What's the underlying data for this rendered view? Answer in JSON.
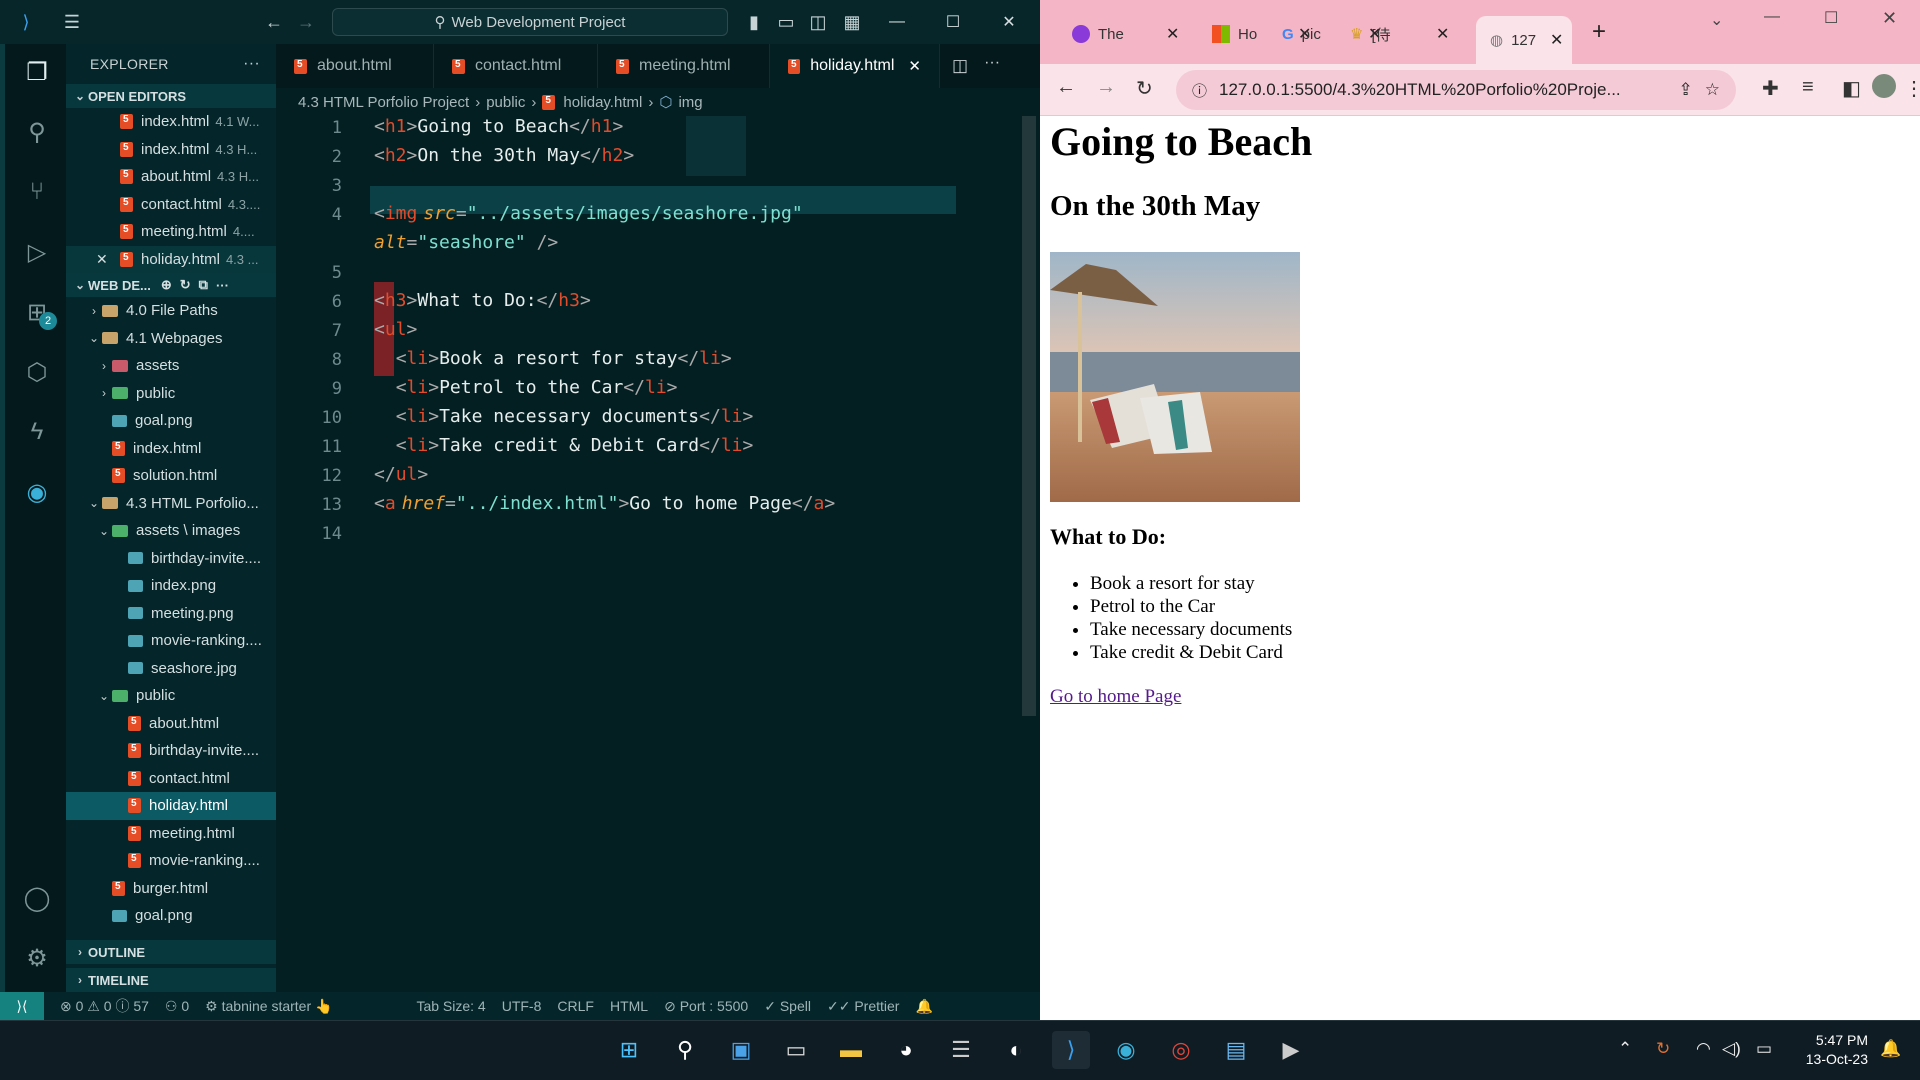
{
  "vscode": {
    "search_text": "Web Development Project",
    "explorer_title": "EXPLORER",
    "open_editors_title": "OPEN EDITORS",
    "open_editors": [
      {
        "name": "index.html",
        "hint": "4.1 W..."
      },
      {
        "name": "index.html",
        "hint": "4.3 H..."
      },
      {
        "name": "about.html",
        "hint": "4.3 H..."
      },
      {
        "name": "contact.html",
        "hint": "4.3...."
      },
      {
        "name": "meeting.html",
        "hint": "4...."
      },
      {
        "name": "holiday.html",
        "hint": "4.3 ..."
      }
    ],
    "workspace_title": "WEB DE...",
    "tree": [
      {
        "label": "4.0 File Paths"
      },
      {
        "label": "4.1 Webpages"
      },
      {
        "label": "assets"
      },
      {
        "label": "public"
      },
      {
        "label": "goal.png"
      },
      {
        "label": "index.html"
      },
      {
        "label": "solution.html"
      },
      {
        "label": "4.3 HTML Porfolio..."
      },
      {
        "label": "assets \\ images"
      },
      {
        "label": "birthday-invite...."
      },
      {
        "label": "index.png"
      },
      {
        "label": "meeting.png"
      },
      {
        "label": "movie-ranking...."
      },
      {
        "label": "seashore.jpg"
      },
      {
        "label": "public"
      },
      {
        "label": "about.html"
      },
      {
        "label": "birthday-invite...."
      },
      {
        "label": "contact.html"
      },
      {
        "label": "holiday.html"
      },
      {
        "label": "meeting.html"
      },
      {
        "label": "movie-ranking...."
      },
      {
        "label": "burger.html"
      },
      {
        "label": "goal.png"
      }
    ],
    "outline_title": "OUTLINE",
    "timeline_title": "TIMELINE",
    "tabs": [
      "about.html",
      "contact.html",
      "meeting.html",
      "holiday.html"
    ],
    "breadcrumb": [
      "4.3 HTML Porfolio Project",
      "public",
      "holiday.html",
      "img"
    ],
    "line_numbers": [
      "1",
      "2",
      "3",
      "4",
      "",
      "5",
      "6",
      "7",
      "8",
      "9",
      "10",
      "11",
      "12",
      "13",
      "14"
    ],
    "status": {
      "problems": "0",
      "warnings": "0",
      "info": "57",
      "ports": "0",
      "tabnine": "tabnine starter",
      "tab_size": "Tab Size: 4",
      "encoding": "UTF-8",
      "eol": "CRLF",
      "language": "HTML",
      "port": "Port : 5500",
      "spell": "Spell",
      "prettier": "Prettier"
    }
  },
  "code_lines": [
    {
      "pre": "<",
      "tag": "h1",
      "mid": ">",
      "text": "Going to Beach",
      "close": "</",
      "ctag": "h1",
      "end": ">"
    },
    {
      "pre": "<",
      "tag": "h2",
      "mid": ">",
      "text": "On the 30th May",
      "close": "</",
      "ctag": "h2",
      "end": ">"
    },
    {
      "pre": "<",
      "tag": "img",
      "attr1": "src",
      "eq1": "=",
      "val1": "\"../assets/images/seashore.jpg\""
    },
    {
      "attr2": "alt",
      "eq2": "=",
      "val2": "\"seashore\"",
      "end": " />"
    },
    {
      "pre": "<",
      "tag": "h3",
      "mid": ">",
      "text": "What to Do:",
      "close": "</",
      "ctag": "h3",
      "end": ">"
    },
    {
      "pre": "<",
      "tag": "ul",
      "end": ">"
    },
    {
      "pre": "<",
      "tag": "li",
      "mid": ">",
      "text": "Book a resort for stay",
      "close": "</",
      "ctag": "li",
      "end": ">"
    },
    {
      "pre": "<",
      "tag": "li",
      "mid": ">",
      "text": "Petrol to the Car",
      "close": "</",
      "ctag": "li",
      "end": ">"
    },
    {
      "pre": "<",
      "tag": "li",
      "mid": ">",
      "text": "Take necessary documents",
      "close": "</",
      "ctag": "li",
      "end": ">"
    },
    {
      "pre": "<",
      "tag": "li",
      "mid": ">",
      "text": "Take credit & Debit Card",
      "close": "</",
      "ctag": "li",
      "end": ">"
    },
    {
      "close": "</",
      "ctag": "ul",
      "end": ">"
    },
    {
      "pre": "<",
      "tag": "a",
      "attr1": "href",
      "eq1": "=",
      "val1": "\"../index.html\"",
      "mid": ">",
      "text": "Go to home Page",
      "close": "</",
      "ctag": "a",
      "end": ">"
    }
  ],
  "browser": {
    "tabs": [
      "The",
      "Ho",
      "pic",
      "[侍",
      "127"
    ],
    "url": "127.0.0.1:5500/4.3%20HTML%20Porfolio%20Proje...",
    "page": {
      "h1": "Going to Beach",
      "h2": "On the 30th May",
      "img_alt": "seashore",
      "h3": "What to Do:",
      "items": [
        "Book a resort for stay",
        "Petrol to the Car",
        "Take necessary documents",
        "Take credit & Debit Card"
      ],
      "link": "Go to home Page"
    }
  },
  "taskbar": {
    "time": "5:47 PM",
    "date": "13-Oct-23"
  }
}
